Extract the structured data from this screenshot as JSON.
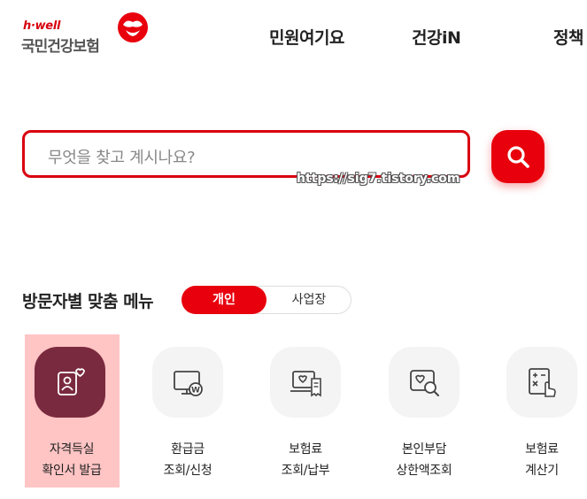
{
  "header": {
    "logo_small": "h·well",
    "logo_main": "국민건강보험",
    "nav": [
      "민원여기요",
      "건강iN",
      "정책"
    ]
  },
  "search": {
    "placeholder": "무엇을 찾고 계시나요?",
    "watermark": "https://sig7.tistory.com"
  },
  "section": {
    "title": "방문자별 맞춤 메뉴",
    "tabs": [
      "개인",
      "사업장"
    ],
    "active_tab": "개인"
  },
  "menu": [
    {
      "line1": "자격득실",
      "line2": "확인서 발급",
      "icon": "id-card-heart-icon"
    },
    {
      "line1": "환급금",
      "line2": "조회/신청",
      "icon": "monitor-won-icon"
    },
    {
      "line1": "보험료",
      "line2": "조회/납부",
      "icon": "laptop-receipt-icon"
    },
    {
      "line1": "본인부담",
      "line2": "상한액조회",
      "icon": "heart-search-icon"
    },
    {
      "line1": "보험료",
      "line2": "계산기",
      "icon": "calculator-hand-icon"
    }
  ],
  "colors": {
    "accent": "#e8000d",
    "selected_icon_bg": "#7a2a3e",
    "highlight": "#ffc4c4"
  }
}
